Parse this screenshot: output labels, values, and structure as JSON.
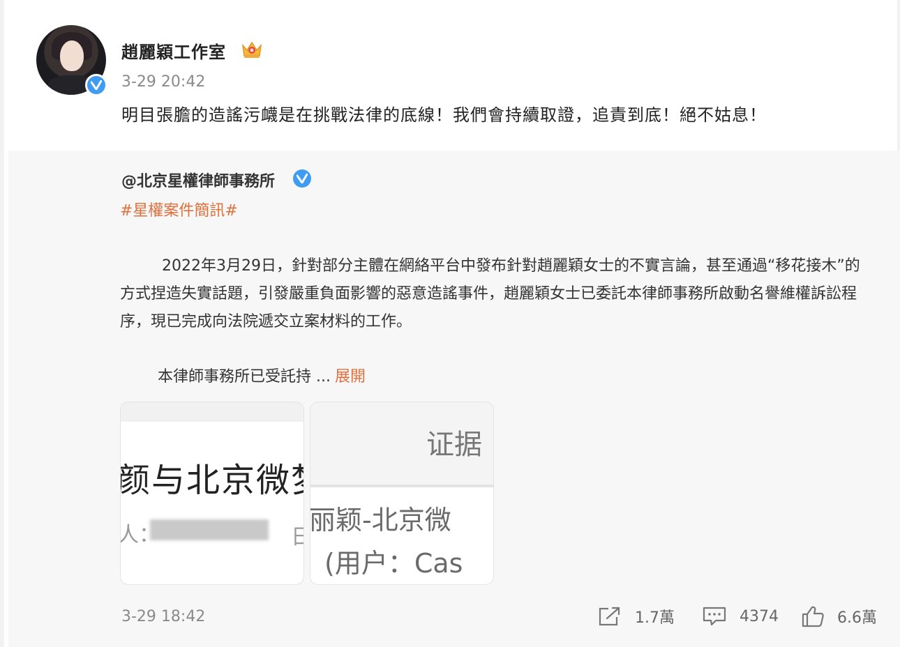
{
  "post": {
    "author": "趙麗穎工作室",
    "timestamp": "3-29 20:42",
    "text": "明目張膽的造謠污衊是在挑戰法律的底線！我們會持續取證，追責到底！絕不姑息！"
  },
  "repost": {
    "author": "@北京星權律師事務所",
    "hashtag": "#星權案件簡訊#",
    "paragraph": "2022年3月29日，針對部分主體在網絡平台中發布針對趙麗穎女士的不實言論，甚至通過“移花接木”的方式捏造失實話題，引發嚴重負面影響的惡意造謠事件，趙麗穎女士已委託本律師事務所啟動名譽維權訴訟程序，現已完成向法院遞交立案材料的工作。",
    "truncated": "本律師事務所已受託持 ...",
    "expand_label": "展開",
    "images": [
      {
        "line1": "颜与北京微梦",
        "line2": "人：",
        "line3_tail": "日"
      },
      {
        "header": "证据",
        "line1": "丽颖-北京微",
        "line2": "(用户：Cas"
      }
    ],
    "timestamp": "3-29 18:42",
    "actions": {
      "share": "1.7萬",
      "comments": "4374",
      "likes": "6.6萬"
    }
  },
  "colors": {
    "accent": "#e0703b",
    "verified": "#3e9cf3",
    "background": "#f7f7f7"
  },
  "icons": [
    "crown-icon",
    "verified-icon",
    "share-icon",
    "comment-icon",
    "like-icon"
  ]
}
